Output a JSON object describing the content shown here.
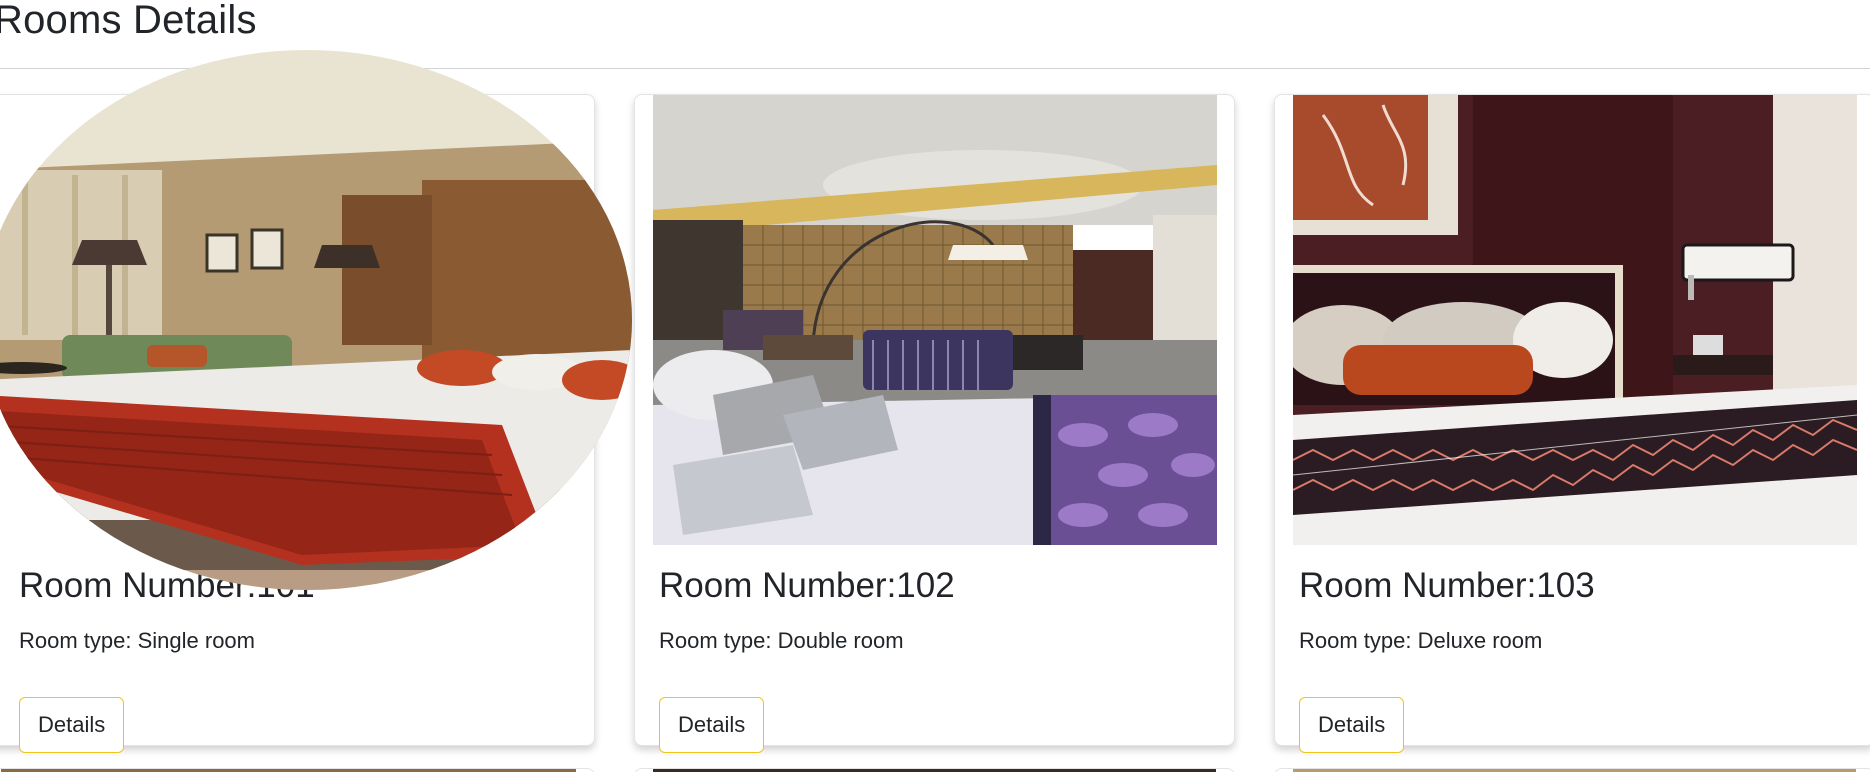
{
  "page": {
    "title": "Rooms Details"
  },
  "rooms": [
    {
      "number": "Room Number:101",
      "type": "Room type: Single room",
      "button": "Details",
      "image": "hotel-room-single-photo"
    },
    {
      "number": "Room Number:102",
      "type": "Room type: Double room",
      "button": "Details",
      "image": "hotel-room-double-photo"
    },
    {
      "number": "Room Number:103",
      "type": "Room type: Deluxe room",
      "button": "Details",
      "image": "hotel-room-deluxe-photo"
    }
  ],
  "colors": {
    "button_border": "#f0c419",
    "text": "#212529",
    "divider": "#cfd2d6"
  }
}
